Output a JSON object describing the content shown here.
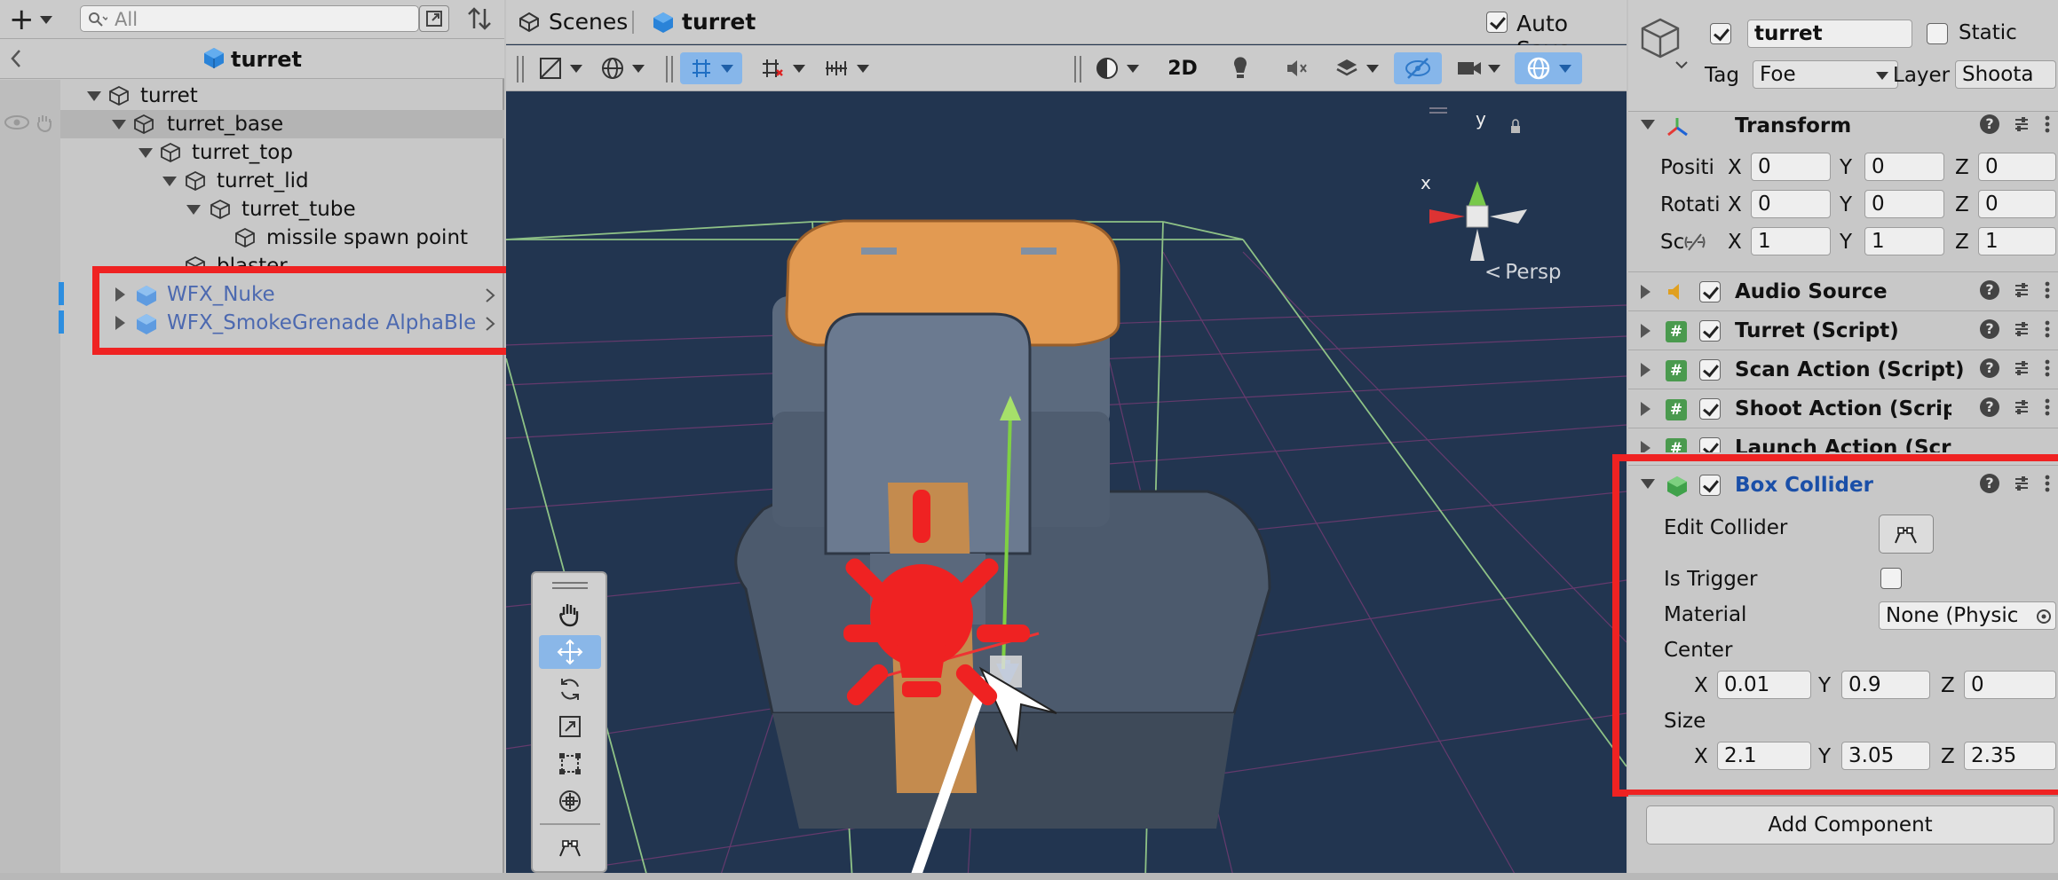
{
  "hierarchy": {
    "search_placeholder": "All",
    "breadcrumb_title": "turret",
    "items": [
      {
        "label": "turret"
      },
      {
        "label": "turret_base"
      },
      {
        "label": "turret_top"
      },
      {
        "label": "turret_lid"
      },
      {
        "label": "turret_tube"
      },
      {
        "label": "missile spawn point"
      },
      {
        "label": "blaster"
      },
      {
        "label": "WFX_Nuke"
      },
      {
        "label": "WFX_SmokeGrenade AlphaBlen"
      }
    ]
  },
  "scene": {
    "tab_scenes": "Scenes",
    "tab_prefab": "turret",
    "auto_save_label": "Auto Save",
    "auto_save_checked": true,
    "button_2d": "2D",
    "gizmo_y": "y",
    "gizmo_x": "x",
    "projection_label": "Persp"
  },
  "inspector": {
    "object_name": "turret",
    "static_label": "Static",
    "tag_label": "Tag",
    "tag_value": "Foe",
    "layer_label": "Layer",
    "layer_value": "Shoota",
    "transform": {
      "title": "Transform",
      "position_label": "Positi",
      "rotation_label": "Rotati",
      "scale_label": "Sc",
      "position": {
        "x": "0",
        "y": "0",
        "z": "0"
      },
      "rotation": {
        "x": "0",
        "y": "0",
        "z": "0"
      },
      "scale": {
        "x": "1",
        "y": "1",
        "z": "1"
      }
    },
    "components": [
      {
        "title": "Audio Source"
      },
      {
        "title": "Turret (Script)"
      },
      {
        "title": "Scan Action (Script)"
      },
      {
        "title": "Shoot Action (Script)"
      },
      {
        "title": "Launch Action (Script)"
      }
    ],
    "box_collider": {
      "title": "Box Collider",
      "edit_collider_label": "Edit Collider",
      "is_trigger_label": "Is Trigger",
      "material_label": "Material",
      "material_value": "None (Physic",
      "center_label": "Center",
      "size_label": "Size",
      "center": {
        "x": "0.01",
        "y": "0.9",
        "z": "0"
      },
      "size": {
        "x": "2.1",
        "y": "3.05",
        "z": "2.35"
      }
    },
    "axis_x": "X",
    "axis_y": "Y",
    "axis_z": "Z",
    "add_component": "Add Component"
  },
  "colors": {
    "highlight": "#ef2222",
    "scene_bg": "#223550",
    "prefab_text": "#4c69b0",
    "selected_tool": "#86b6ea"
  }
}
